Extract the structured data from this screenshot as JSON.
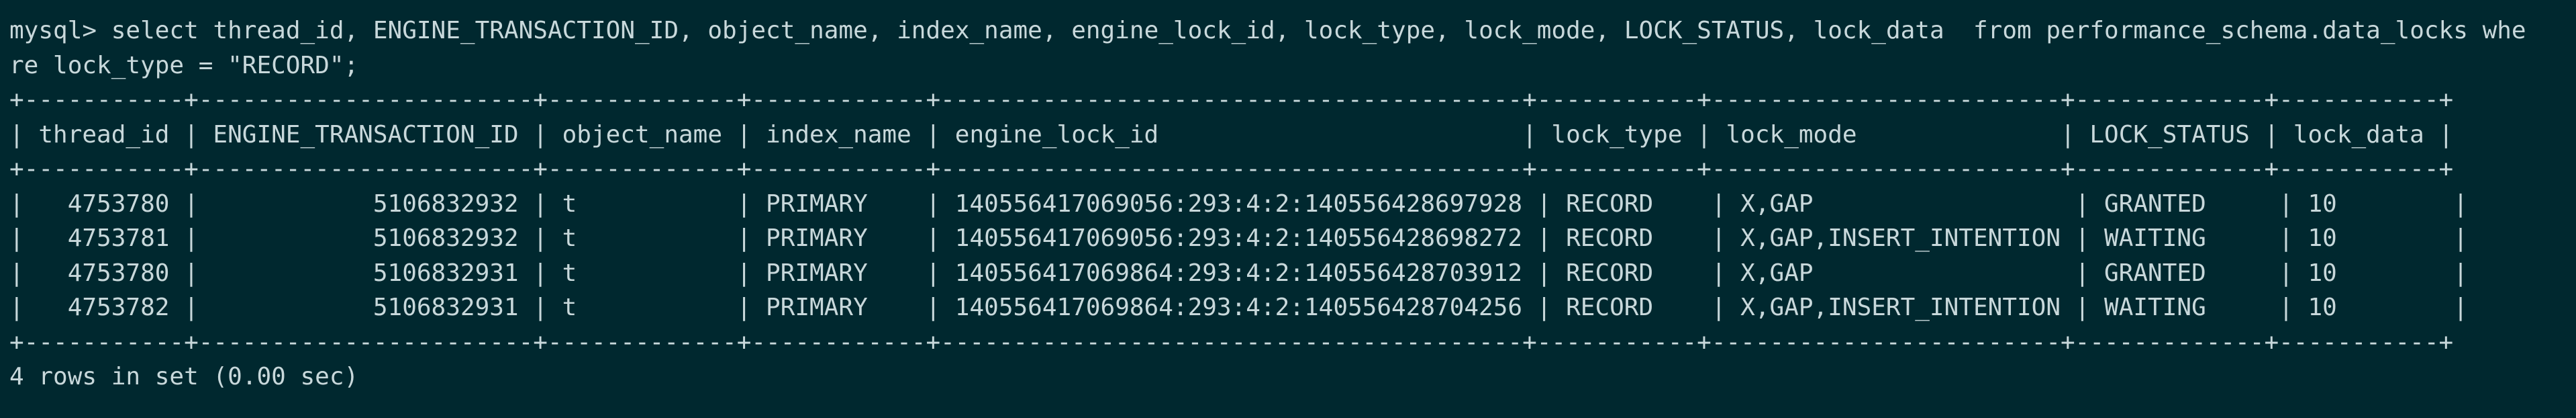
{
  "terminal": {
    "prompt": "mysql>",
    "command_line_1": "select thread_id, ENGINE_TRANSACTION_ID, object_name, index_name, engine_lock_id, lock_type, lock_mode, LOCK_STATUS, lock_data  from performance_schema.data_locks whe",
    "command_line_2": "re lock_type = \"RECORD\";",
    "border": "+-----------+-----------------------+-------------+------------+----------------------------------------+-----------+------------------------+-------------+-----------+",
    "header": "| thread_id | ENGINE_TRANSACTION_ID | object_name | index_name | engine_lock_id                         | lock_type | lock_mode              | LOCK_STATUS | lock_data |",
    "rows": [
      "|   4753780 |            5106832932 | t           | PRIMARY    | 140556417069056:293:4:2:140556428697928 | RECORD    | X,GAP                  | GRANTED     | 10        |",
      "|   4753781 |            5106832932 | t           | PRIMARY    | 140556417069056:293:4:2:140556428698272 | RECORD    | X,GAP,INSERT_INTENTION | WAITING     | 10        |",
      "|   4753780 |            5106832931 | t           | PRIMARY    | 140556417069864:293:4:2:140556428703912 | RECORD    | X,GAP                  | GRANTED     | 10        |",
      "|   4753782 |            5106832931 | t           | PRIMARY    | 140556417069864:293:4:2:140556428704256 | RECORD    | X,GAP,INSERT_INTENTION | WAITING     | 10        |"
    ],
    "result_summary": "4 rows in set (0.00 sec)"
  }
}
